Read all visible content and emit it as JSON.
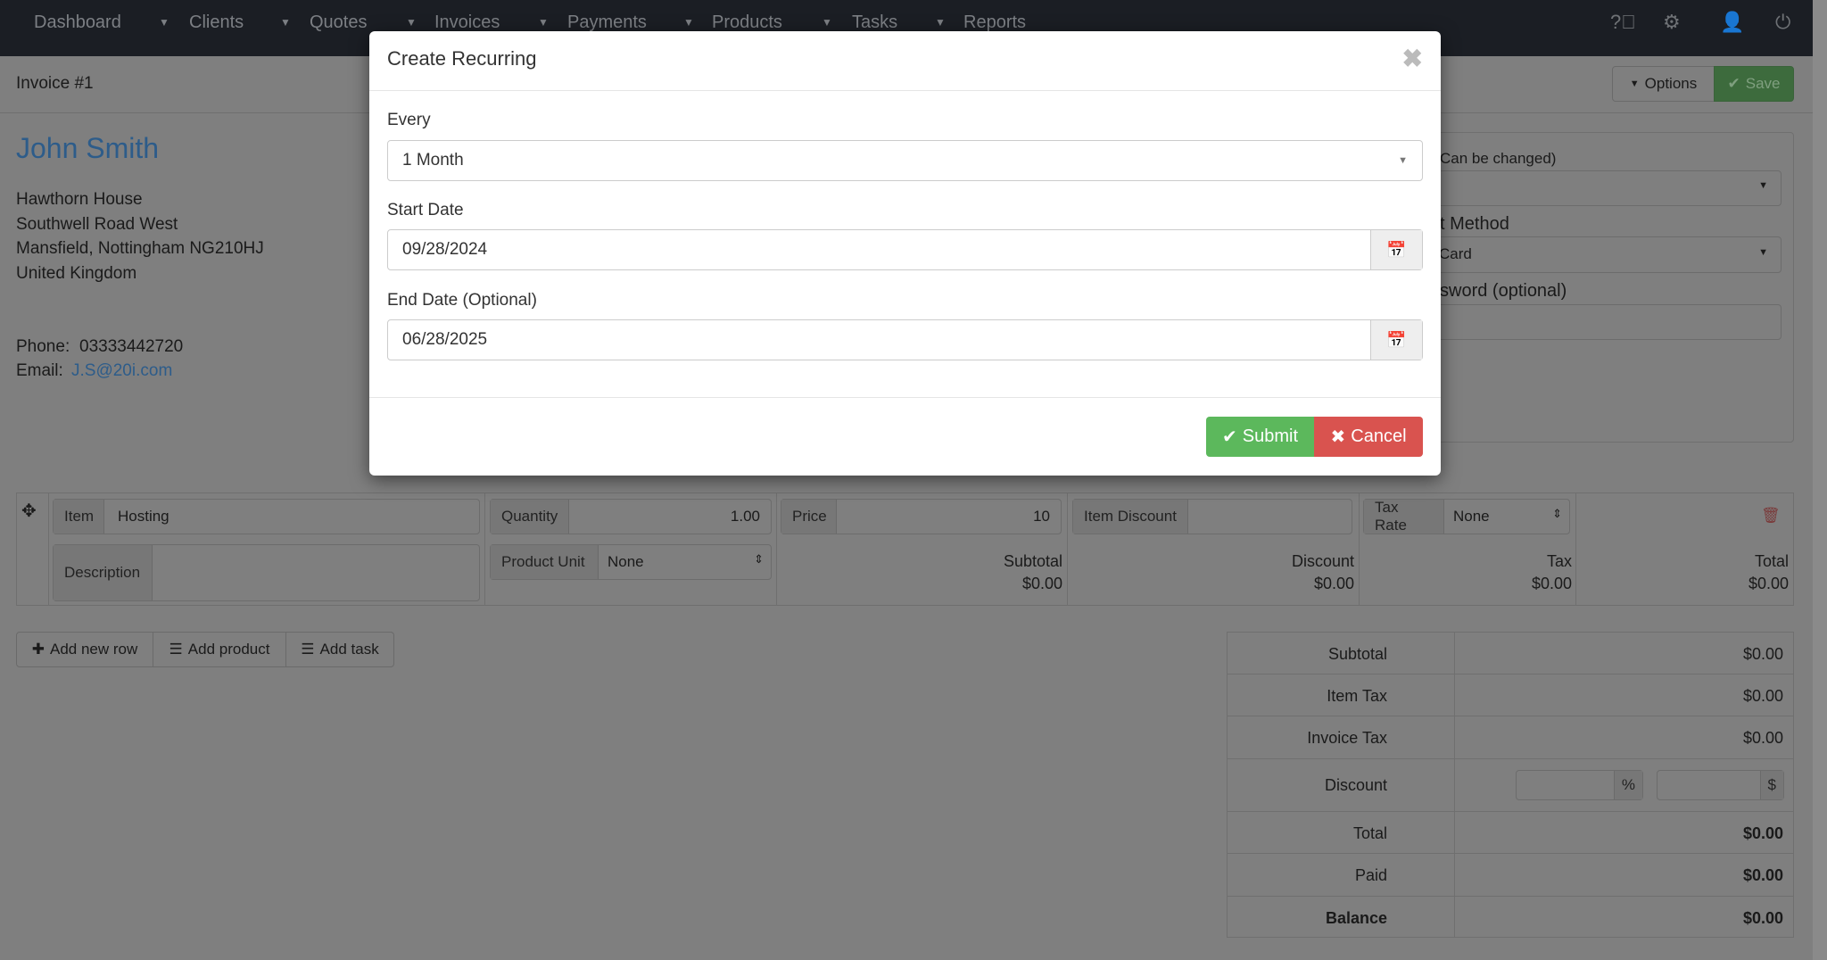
{
  "nav": {
    "items": [
      "Dashboard",
      "Clients",
      "Quotes",
      "Invoices",
      "Payments",
      "Products",
      "Tasks",
      "Reports"
    ],
    "icons": [
      "help-icon",
      "settings-icon",
      "user-icon",
      "power-icon"
    ]
  },
  "header": {
    "title": "Invoice #1",
    "options": "Options",
    "save": "Save"
  },
  "client": {
    "name": "John Smith",
    "address": [
      "Hawthorn House",
      "Southwell Road West",
      "Mansfield, Nottingham NG210HJ",
      "United Kingdom"
    ],
    "phone_label": "Phone:",
    "phone": "03333442720",
    "email_label": "Email:",
    "email": "J.S@20i.com"
  },
  "right_panel": {
    "label1": "Can be changed)",
    "label2": "t Method",
    "method_value": "Card",
    "label3": "sword (optional)"
  },
  "item": {
    "item_label": "Item",
    "item_value": "Hosting",
    "qty_label": "Quantity",
    "qty_value": "1.00",
    "price_label": "Price",
    "price_value": "10",
    "discount_label": "Item Discount",
    "discount_value": "",
    "tax_label": "Tax Rate",
    "tax_value": "None",
    "desc_label": "Description",
    "unit_label": "Product Unit",
    "unit_value": "None",
    "subtotal_label": "Subtotal",
    "subtotal": "$0.00",
    "disc_label": "Discount",
    "disc": "$0.00",
    "taxc_label": "Tax",
    "taxc": "$0.00",
    "total_label": "Total",
    "total": "$0.00"
  },
  "actions": {
    "add_row": "Add new row",
    "add_product": "Add product",
    "add_task": "Add task"
  },
  "totals": [
    {
      "label": "Subtotal",
      "value": "$0.00"
    },
    {
      "label": "Item Tax",
      "value": "$0.00"
    },
    {
      "label": "Invoice Tax",
      "value": "$0.00"
    },
    {
      "label": "Discount",
      "pct": "%",
      "cur": "$"
    },
    {
      "label": "Total",
      "value": "$0.00"
    },
    {
      "label": "Paid",
      "value": "$0.00"
    },
    {
      "label": "Balance",
      "value": "$0.00"
    }
  ],
  "modal": {
    "title": "Create Recurring",
    "every_label": "Every",
    "every_value": "1 Month",
    "start_label": "Start Date",
    "start_value": "09/28/2024",
    "end_label": "End Date (Optional)",
    "end_value": "06/28/2025",
    "submit": "Submit",
    "cancel": "Cancel"
  },
  "colors": {
    "submit": "#5cb85c",
    "cancel": "#d9534f",
    "link": "#337ab7"
  }
}
